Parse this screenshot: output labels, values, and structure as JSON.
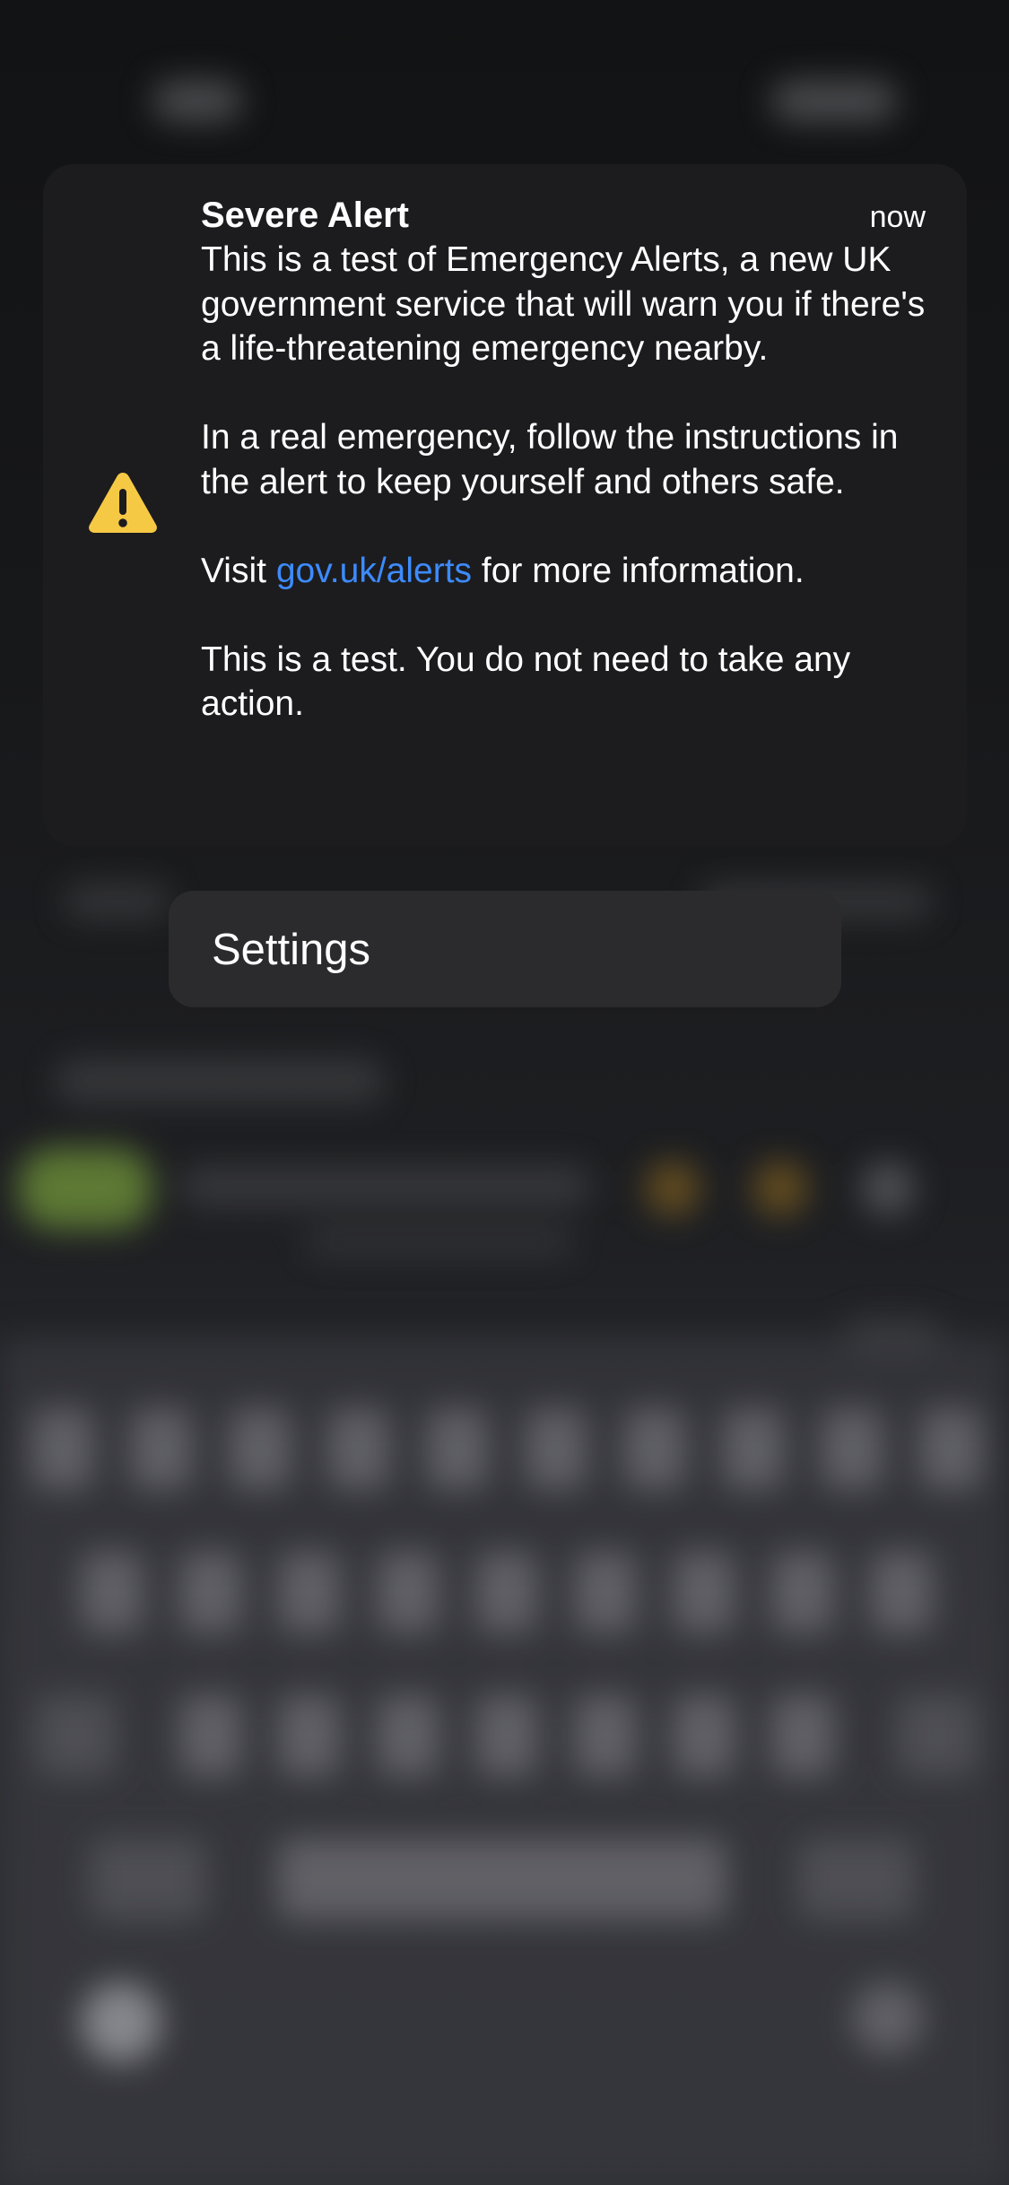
{
  "notification": {
    "title": "Severe Alert",
    "time": "now",
    "icon": "warning-icon",
    "paragraph1": "This is a test of Emergency Alerts, a new UK government service that will warn you if there's a life-threatening emergency nearby.",
    "paragraph2": "In a real emergency, follow the instructions in the alert to keep yourself and others safe.",
    "paragraph3_before": "Visit ",
    "paragraph3_link": "gov.uk/alerts",
    "paragraph3_after": " for more information.",
    "paragraph4": "This is a test. You do not need to take any action."
  },
  "menu": {
    "settings_label": "Settings"
  },
  "colors": {
    "link": "#3d8bfd",
    "warning_fill": "#f6c945",
    "card_bg": "#1c1c1e",
    "menu_bg": "#2b2b2d"
  }
}
